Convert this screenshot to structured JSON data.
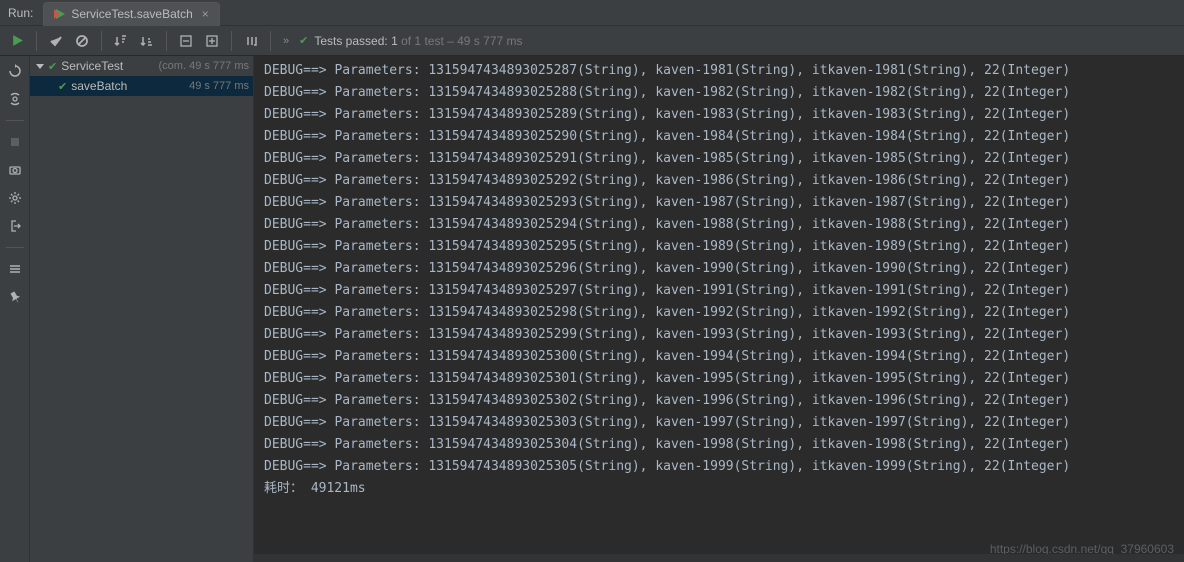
{
  "topbar": {
    "run_label": "Run:",
    "tab_title": "ServiceTest.saveBatch",
    "tab_close": "×"
  },
  "status": {
    "chevrons": "»",
    "prefix": "Tests passed:",
    "count": "1",
    "of_text": "of 1 test – 49 s 777 ms"
  },
  "tree": {
    "root": {
      "name": "ServiceTest",
      "detail": "(com. 49 s 777 ms"
    },
    "child": {
      "name": "saveBatch",
      "detail": "49 s 777 ms"
    }
  },
  "console": {
    "lines": [
      "DEBUG==>  Parameters: 1315947434893025287(String), kaven-1981(String), itkaven-1981(String), 22(Integer)",
      "DEBUG==>  Parameters: 1315947434893025288(String), kaven-1982(String), itkaven-1982(String), 22(Integer)",
      "DEBUG==>  Parameters: 1315947434893025289(String), kaven-1983(String), itkaven-1983(String), 22(Integer)",
      "DEBUG==>  Parameters: 1315947434893025290(String), kaven-1984(String), itkaven-1984(String), 22(Integer)",
      "DEBUG==>  Parameters: 1315947434893025291(String), kaven-1985(String), itkaven-1985(String), 22(Integer)",
      "DEBUG==>  Parameters: 1315947434893025292(String), kaven-1986(String), itkaven-1986(String), 22(Integer)",
      "DEBUG==>  Parameters: 1315947434893025293(String), kaven-1987(String), itkaven-1987(String), 22(Integer)",
      "DEBUG==>  Parameters: 1315947434893025294(String), kaven-1988(String), itkaven-1988(String), 22(Integer)",
      "DEBUG==>  Parameters: 1315947434893025295(String), kaven-1989(String), itkaven-1989(String), 22(Integer)",
      "DEBUG==>  Parameters: 1315947434893025296(String), kaven-1990(String), itkaven-1990(String), 22(Integer)",
      "DEBUG==>  Parameters: 1315947434893025297(String), kaven-1991(String), itkaven-1991(String), 22(Integer)",
      "DEBUG==>  Parameters: 1315947434893025298(String), kaven-1992(String), itkaven-1992(String), 22(Integer)",
      "DEBUG==>  Parameters: 1315947434893025299(String), kaven-1993(String), itkaven-1993(String), 22(Integer)",
      "DEBUG==>  Parameters: 1315947434893025300(String), kaven-1994(String), itkaven-1994(String), 22(Integer)",
      "DEBUG==>  Parameters: 1315947434893025301(String), kaven-1995(String), itkaven-1995(String), 22(Integer)",
      "DEBUG==>  Parameters: 1315947434893025302(String), kaven-1996(String), itkaven-1996(String), 22(Integer)",
      "DEBUG==>  Parameters: 1315947434893025303(String), kaven-1997(String), itkaven-1997(String), 22(Integer)",
      "DEBUG==>  Parameters: 1315947434893025304(String), kaven-1998(String), itkaven-1998(String), 22(Integer)",
      "DEBUG==>  Parameters: 1315947434893025305(String), kaven-1999(String), itkaven-1999(String), 22(Integer)",
      "耗时： 49121ms"
    ]
  },
  "watermark": "https://blog.csdn.net/qq_37960603"
}
